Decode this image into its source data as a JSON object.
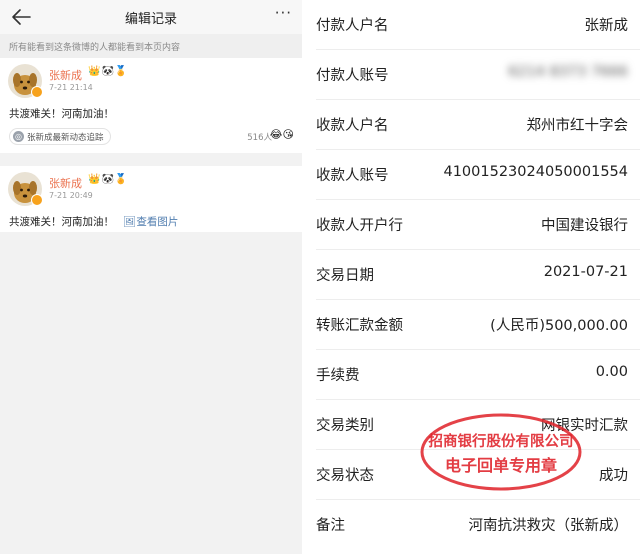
{
  "header": {
    "title": "编辑记录",
    "more_label": "···"
  },
  "notice": "所有能看到这条微博的人都能看到本页内容",
  "posts": [
    {
      "user": "张新成",
      "time": "7-21 21:14",
      "text": "共渡难关！河南加油！",
      "follow_label": "张新成最新动态追踪",
      "likes": "516人"
    },
    {
      "user": "张新成",
      "time": "7-21 20:49",
      "text": "共渡难关！河南加油！",
      "view_pic": "查看图片"
    }
  ],
  "receipt": {
    "rows": [
      {
        "label": "付款人户名",
        "value": "张新成"
      },
      {
        "label": "付款人账号",
        "value": "6214 8373 7666"
      },
      {
        "label": "收款人户名",
        "value": "郑州市红十字会"
      },
      {
        "label": "收款人账号",
        "value": "41001523024050001554"
      },
      {
        "label": "收款人开户行",
        "value": "中国建设银行"
      },
      {
        "label": "交易日期",
        "value": "2021-07-21"
      },
      {
        "label": "转账汇款金额",
        "value": "(人民币)500,000.00"
      },
      {
        "label": "手续费",
        "value": "0.00"
      },
      {
        "label": "交易类别",
        "value": "网银实时汇款"
      },
      {
        "label": "交易状态",
        "value": "成功"
      },
      {
        "label": "备注",
        "value": "河南抗洪救灾（张新成）"
      }
    ],
    "stamp": {
      "line1": "招商银行股份有限公司",
      "line2": "电子回单专用章",
      "color": "#e0282f"
    }
  },
  "colors": {
    "username": "#eb7350",
    "link": "#507daf",
    "stamp": "#e0282f"
  }
}
